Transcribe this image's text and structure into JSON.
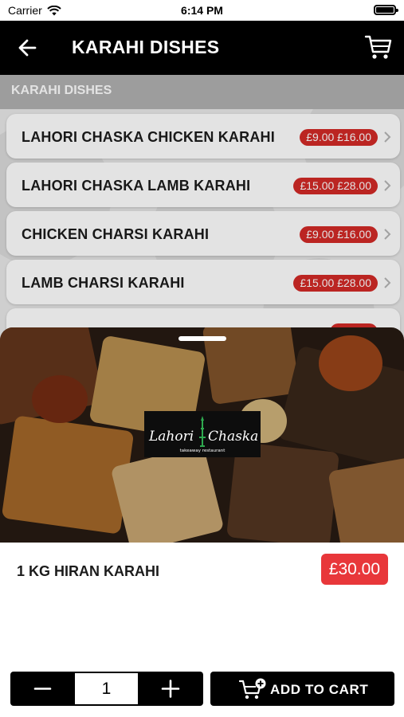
{
  "status_bar": {
    "carrier": "Carrier",
    "time": "6:14 PM"
  },
  "nav": {
    "title": "KARAHI DISHES",
    "back_icon": "arrow-left-icon",
    "cart_icon": "shopping-cart-icon"
  },
  "section": {
    "title": "KARAHI DISHES"
  },
  "dishes": [
    {
      "name": "LAHORI CHASKA CHICKEN KARAHI",
      "price": "£9.00 £16.00"
    },
    {
      "name": "LAHORI CHASKA LAMB KARAHI",
      "price": "£15.00 £28.00"
    },
    {
      "name": "CHICKEN CHARSI KARAHI",
      "price": "£9.00 £16.00"
    },
    {
      "name": "LAMB CHARSI KARAHI",
      "price": "£15.00 £28.00"
    }
  ],
  "logo": {
    "name": "Lahori Chaska",
    "tagline": "takeaway restaurant"
  },
  "item": {
    "name": "1 KG HIRAN KARAHI",
    "price": "£30.00"
  },
  "quantity": {
    "value": "1",
    "minus_icon": "minus-icon",
    "plus_icon": "plus-icon"
  },
  "add_to_cart": {
    "label": "ADD TO CART",
    "icon": "cart-add-icon"
  },
  "colors": {
    "accent": "#e8373a",
    "price_badge": "#d32a27",
    "nav_bg": "#000000",
    "section_bg": "#b1b1b1"
  }
}
